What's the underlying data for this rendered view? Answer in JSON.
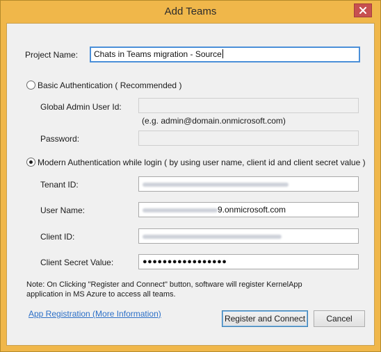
{
  "window": {
    "title": "Add Teams"
  },
  "form": {
    "project_name": {
      "label": "Project Name:",
      "value": "Chats in Teams migration - Source"
    },
    "basic_auth": {
      "label": "Basic Authentication ( Recommended )",
      "selected": false,
      "admin_user_id": {
        "label": "Global Admin User Id:",
        "value": "",
        "hint": "(e.g. admin@domain.onmicrosoft.com)"
      },
      "password": {
        "label": "Password:",
        "value": ""
      }
    },
    "modern_auth": {
      "label": "Modern Authentication while login ( by using user name, client id and client secret value )",
      "selected": true,
      "tenant_id": {
        "label": "Tenant ID:"
      },
      "user_name": {
        "label": "User Name:",
        "visible_suffix": "9.onmicrosoft.com"
      },
      "client_id": {
        "label": "Client ID:"
      },
      "client_secret": {
        "label": "Client Secret Value:",
        "masked_value": "●●●●●●●●●●●●●●●●●"
      }
    }
  },
  "note": {
    "line1": "Note: On Clicking \"Register and Connect\" button, software will register KernelApp",
    "line2": "application in MS Azure to access all teams."
  },
  "footer": {
    "app_registration_link": "App Registration (More Information)",
    "register_button": "Register and Connect",
    "cancel_button": "Cancel"
  },
  "colors": {
    "titlebar": "#f0b74a",
    "close_button": "#c75050",
    "dialog_background": "#f0f0f0",
    "link": "#2b6fc7",
    "focus_border": "#4a8fd8"
  },
  "icons": {
    "close": "close-x-icon"
  }
}
